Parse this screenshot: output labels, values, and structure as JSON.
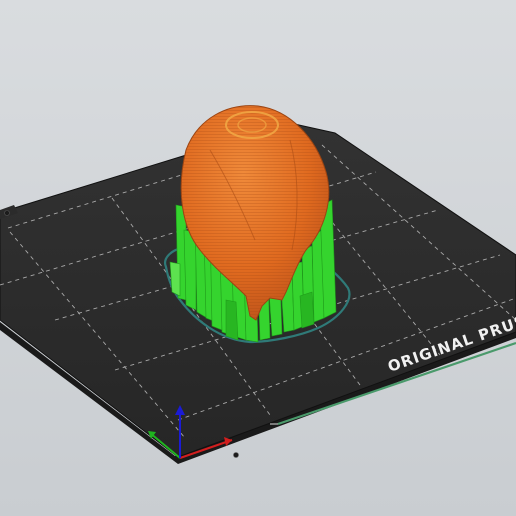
{
  "viewport": {
    "background_top": "#d9dcdf",
    "background_bottom": "#c9cdd1"
  },
  "bed": {
    "brand_text": "ORIGINAL PRUSA",
    "sheet_color": "#2b2b2b",
    "edge_color": "#1a1a1a",
    "grid_color": "#bfbfbf",
    "accent_strip_color": "#4a9a6b"
  },
  "model": {
    "object_color": "#e06a1f",
    "support_color": "#35d42e",
    "skirt_color": "#2f7a78"
  },
  "axes": {
    "x_color": "#d21e1e",
    "y_color": "#1fb51f",
    "z_color": "#1b1bd6"
  }
}
